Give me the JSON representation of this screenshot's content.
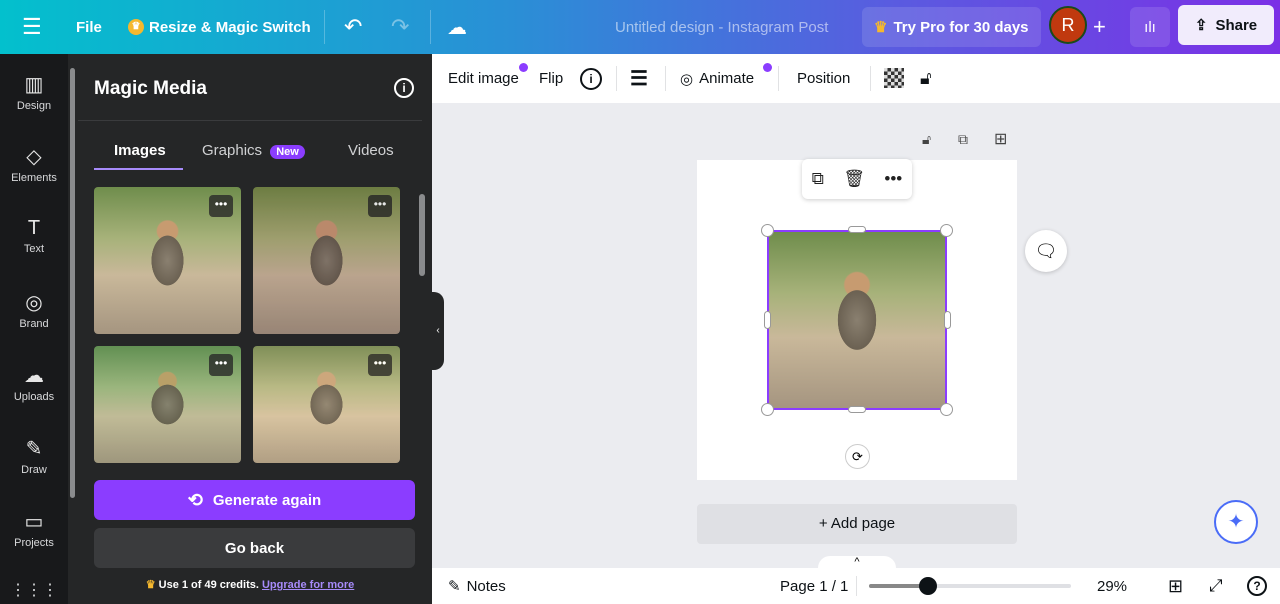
{
  "topbar": {
    "file": "File",
    "resize": "Resize & Magic Switch",
    "title": "Untitled design - Instagram Post",
    "try_pro": "Try Pro for 30 days",
    "avatar": "R",
    "share": "Share"
  },
  "rail": [
    {
      "label": "Design",
      "icon": "▥"
    },
    {
      "label": "Elements",
      "icon": "◇"
    },
    {
      "label": "Text",
      "icon": "T"
    },
    {
      "label": "Brand",
      "icon": "◎"
    },
    {
      "label": "Uploads",
      "icon": "☁"
    },
    {
      "label": "Draw",
      "icon": "✎"
    },
    {
      "label": "Projects",
      "icon": "▭"
    }
  ],
  "panel": {
    "title": "Magic Media",
    "tabs": [
      "Images",
      "Graphics",
      "Videos"
    ],
    "new_badge": "New",
    "generate": "Generate again",
    "go_back": "Go back",
    "credits": "Use 1 of 49 credits.",
    "upgrade": "Upgrade for more"
  },
  "toolbar": {
    "edit_image": "Edit image",
    "flip": "Flip",
    "animate": "Animate",
    "position": "Position"
  },
  "canvas": {
    "add_page": "+ Add page"
  },
  "bottom": {
    "notes": "Notes",
    "page": "Page 1 / 1",
    "zoom": "29%",
    "zoom_fraction": 0.29
  },
  "colors": {
    "accent": "#8b3dff",
    "selection": "#8b3dff"
  }
}
